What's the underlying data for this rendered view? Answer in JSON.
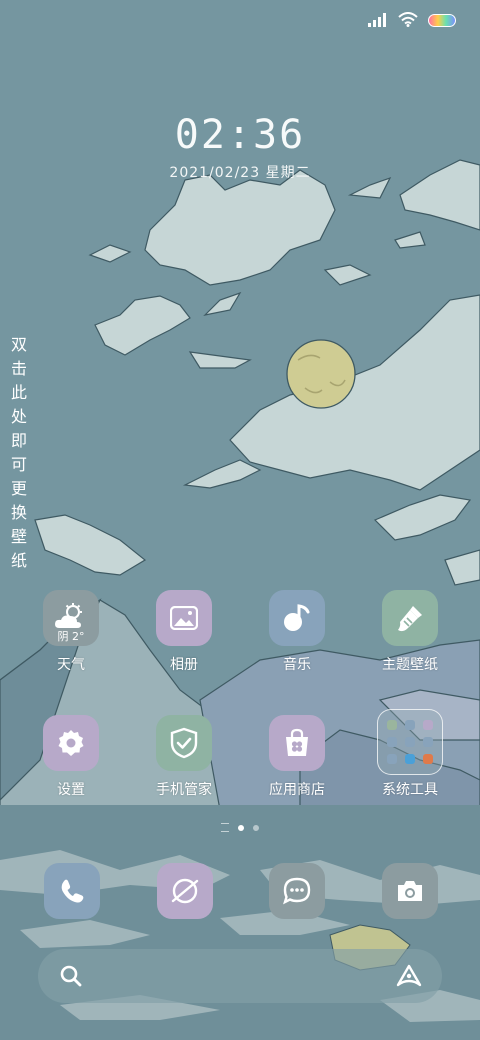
{
  "status_bar": {
    "icons": [
      "signal-icon",
      "wifi-icon",
      "battery-icon"
    ]
  },
  "lockscreen": {
    "time": "02:36",
    "date": "2021/02/23 星期二",
    "hint_chars": [
      "双",
      "击",
      "此",
      "处",
      "即",
      "可",
      "更",
      "换",
      "壁",
      "纸"
    ]
  },
  "weather_badge": "阴 2°",
  "apps": {
    "weather": "天气",
    "gallery": "相册",
    "music": "音乐",
    "themes": "主题壁纸",
    "settings": "设置",
    "security": "手机管家",
    "app_store": "应用商店",
    "tools_folder": "系统工具"
  },
  "page_indicator": {
    "pages": 2,
    "current": 1
  },
  "dock": [
    "phone-icon",
    "browser-icon",
    "messages-icon",
    "camera-icon"
  ],
  "search": {
    "icons": [
      "search-icon",
      "assistant-icon"
    ]
  },
  "colors": {
    "sky": "#7596a0",
    "cloud": "#c6d6d6",
    "moon": "#cfcc93",
    "icon_gray": "#8c9ca0",
    "icon_lavender": "#b7a9c9",
    "icon_blue": "#88a3bb",
    "icon_green": "#8fb3a3"
  }
}
